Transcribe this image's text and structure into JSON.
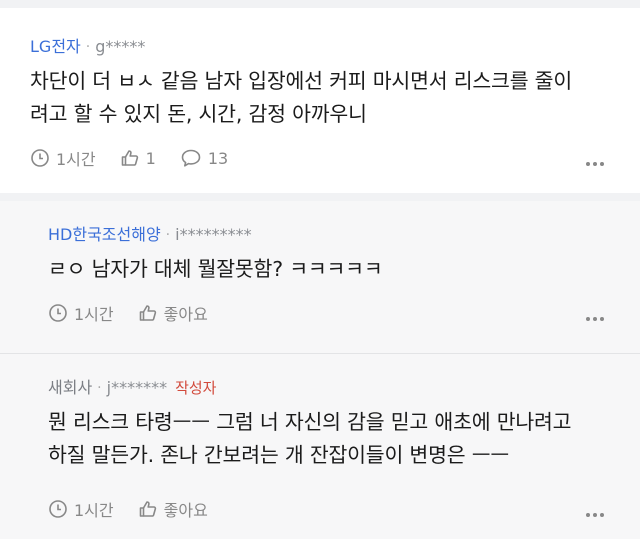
{
  "comments": [
    {
      "author": "LG전자",
      "user_id": "g*****",
      "text_lines": [
        "차단이 더 ㅂㅅ 같음 남자 입장에선 커피 마시면서 리스크를 줄이",
        "려고 할 수 있지 돈, 시간, 감정 아까우니"
      ],
      "time": "1시간",
      "likes": "1",
      "replies": "13"
    },
    {
      "author": "HD한국조선해양",
      "user_id": "i*********",
      "text_lines": [
        "ㄹㅇ 남자가 대체 뭘잘못함? ㅋㅋㅋㅋㅋ"
      ],
      "time": "1시간",
      "like_label": "좋아요"
    },
    {
      "author": "새회사",
      "user_id": "j*******",
      "writer_tag": "작성자",
      "text_lines": [
        "뭔 리스크 타령ㅡㅡ 그럼 너 자신의 감을 믿고 애초에 만나려고",
        "하질 말든가. 존나 간보려는 개 잔잡이들이 변명은 ㅡㅡ"
      ],
      "time": "1시간",
      "like_label": "좋아요"
    }
  ],
  "colors": {
    "author_blue": "#3b6fd8",
    "writer_tag_red": "#d24a3c",
    "meta_gray": "#888888"
  }
}
